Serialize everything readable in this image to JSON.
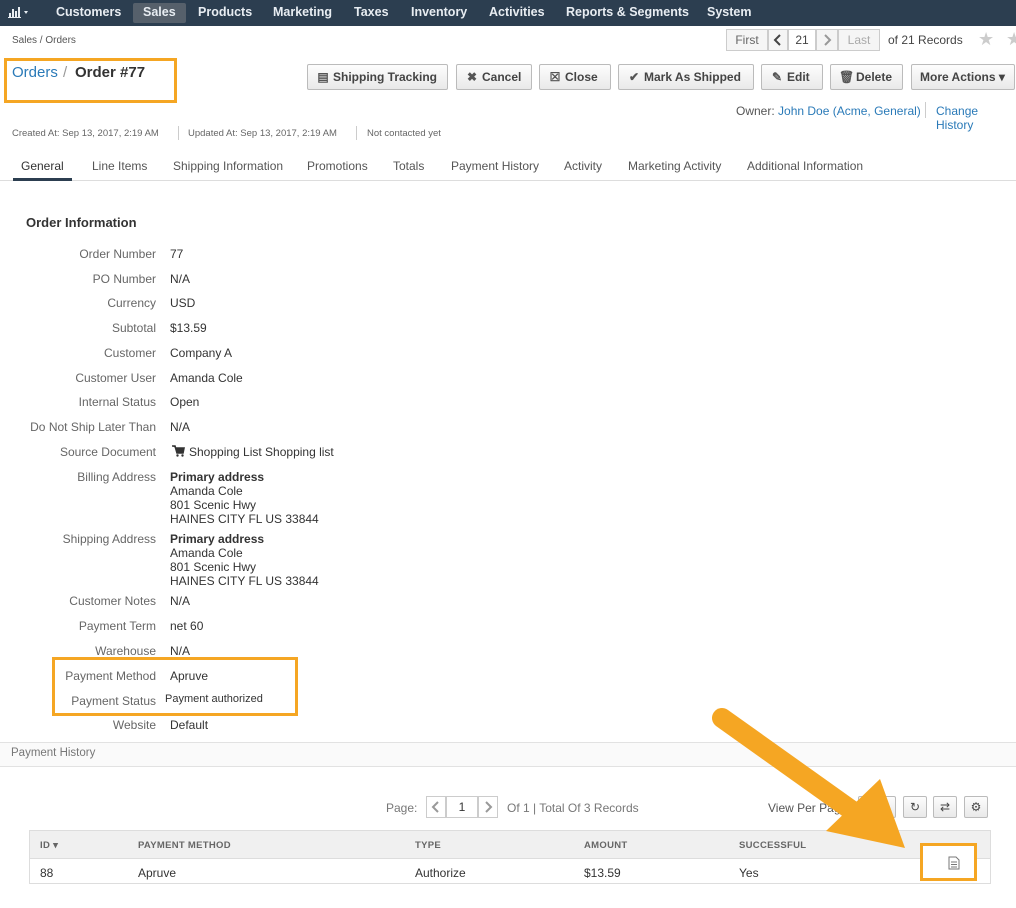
{
  "topnav": {
    "items": [
      "Customers",
      "Sales",
      "Products",
      "Marketing",
      "Taxes",
      "Inventory",
      "Activities",
      "Reports & Segments",
      "System"
    ]
  },
  "breadcrumb": "Sales / Orders",
  "pager": {
    "first": "First",
    "current": "21",
    "last": "Last",
    "records": "of 21 Records"
  },
  "title": {
    "entity": "Orders",
    "separator": "/",
    "record": "Order #77"
  },
  "buttons": {
    "shipping_tracking": "Shipping Tracking",
    "cancel": "Cancel",
    "close": "Close",
    "mark_shipped": "Mark As Shipped",
    "edit": "Edit",
    "delete": "Delete",
    "more_actions": "More Actions"
  },
  "owner": {
    "label": "Owner:",
    "name": "John Doe",
    "org": "(Acme, General)",
    "history": "Change History"
  },
  "meta": {
    "created": "Created At: Sep 13, 2017, 2:19 AM",
    "updated": "Updated At: Sep 13, 2017, 2:19 AM",
    "contacted": "Not contacted yet"
  },
  "tabs": [
    "General",
    "Line Items",
    "Shipping Information",
    "Promotions",
    "Totals",
    "Payment History",
    "Activity",
    "Marketing Activity",
    "Additional Information"
  ],
  "order_info": {
    "title": "Order Information",
    "order_number_label": "Order Number",
    "order_number": "77",
    "po_label": "PO Number",
    "po": "N/A",
    "currency_label": "Currency",
    "currency": "USD",
    "subtotal_label": "Subtotal",
    "subtotal": "$13.59",
    "customer_label": "Customer",
    "customer": "Company A",
    "customer_user_label": "Customer User",
    "customer_user": "Amanda Cole",
    "internal_status_label": "Internal Status",
    "internal_status": "Open",
    "dnsl_label": "Do Not Ship Later Than",
    "dnsl": "N/A",
    "source_label": "Source Document",
    "source": "Shopping List Shopping list",
    "billing_label": "Billing Address",
    "billing": {
      "title": "Primary address",
      "name": "Amanda Cole",
      "street": "801 Scenic Hwy",
      "city": "HAINES CITY FL US 33844"
    },
    "shipping_label": "Shipping Address",
    "shipping": {
      "title": "Primary address",
      "name": "Amanda Cole",
      "street": "801 Scenic Hwy",
      "city": "HAINES CITY FL US 33844"
    },
    "notes_label": "Customer Notes",
    "notes": "N/A",
    "term_label": "Payment Term",
    "term": "net 60",
    "warehouse_label": "Warehouse",
    "warehouse": "N/A",
    "method_label": "Payment Method",
    "method": "Apruve",
    "pstatus_label": "Payment Status",
    "pstatus": "Payment authorized",
    "website_label": "Website",
    "website": "Default"
  },
  "payment_history": {
    "title": "Payment History",
    "page_label": "Page:",
    "page": "1",
    "page_info": "Of 1 | Total Of 3 Records",
    "view_per_page": "View Per Page:",
    "per_page_value": "25",
    "columns": [
      "ID",
      "PAYMENT METHOD",
      "TYPE",
      "AMOUNT",
      "SUCCESSFUL"
    ],
    "row": {
      "id": "88",
      "method": "Apruve",
      "type": "Authorize",
      "amount": "$13.59",
      "successful": "Yes"
    }
  },
  "colors": {
    "nav": "#2c3e50",
    "link": "#2a7ab8",
    "highlight": "#f5a623"
  },
  "icons": [
    "chart-icon",
    "chevron-left-icon",
    "chevron-right-icon",
    "star-icon",
    "cart-icon",
    "refresh-icon",
    "reset-icon",
    "gear-icon",
    "view-icon",
    "arrow-annotation"
  ]
}
